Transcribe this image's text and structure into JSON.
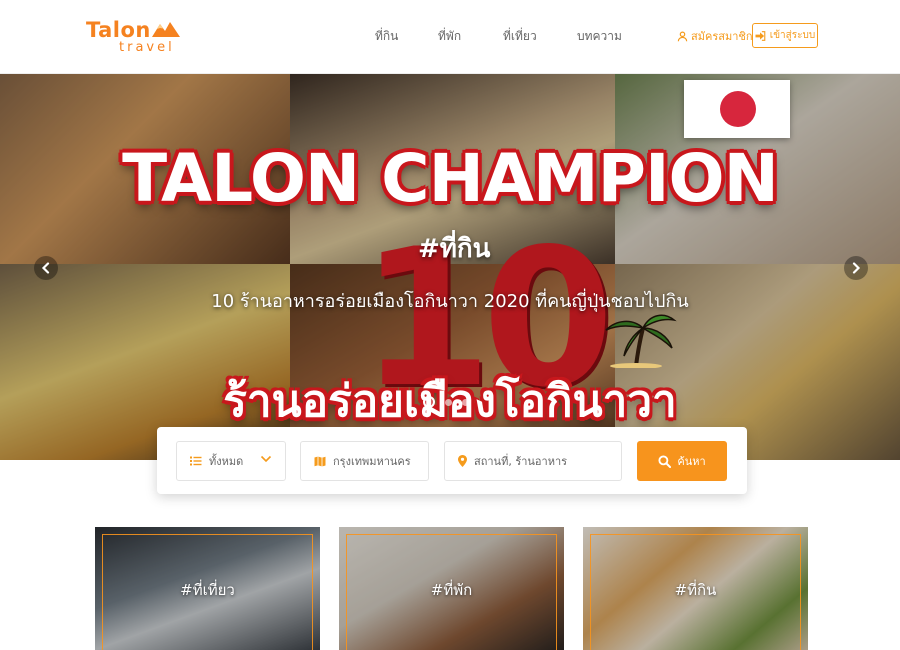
{
  "brand": {
    "name": "Talon",
    "sub": "travel",
    "color": "#f58220"
  },
  "nav": {
    "items": [
      {
        "label": "ที่กิน"
      },
      {
        "label": "ที่พัก"
      },
      {
        "label": "ที่เที่ยว"
      },
      {
        "label": "บทความ"
      }
    ]
  },
  "account": {
    "signup_label": "สมัครสมาชิก",
    "signup_icon": "user-icon",
    "login_label": "เข้าสู่ระบบ",
    "login_icon": "sign-in-icon",
    "accent": "#f59b1c"
  },
  "hero": {
    "title": "TALON CHAMPION",
    "hashtag": "#ที่กิน",
    "number": "10",
    "caption": "10 ร้านอาหารอร่อยเมืองโอกินาวา 2020 ที่คนญี่ปุ่นชอบไปกิน",
    "bottom_text": "ร้านอร่อยเมืองโอกินาวา",
    "prev_icon": "chevron-left-icon",
    "next_icon": "chevron-right-icon",
    "slides_total": 3,
    "active_slide": 1
  },
  "search": {
    "category_value": "ทั้งหมด",
    "category_icon": "list-icon",
    "city_value": "กรุงเทพมหานคร",
    "city_icon": "map-icon",
    "place_placeholder": "สถานที่, ร้านอาหาร",
    "place_icon": "map-marker-icon",
    "button_label": "ค้นหา",
    "button_icon": "search-icon",
    "button_color": "#f7941d"
  },
  "categories": [
    {
      "label": "#ที่เที่ยว"
    },
    {
      "label": "#ที่พัก"
    },
    {
      "label": "#ที่กิน"
    }
  ]
}
